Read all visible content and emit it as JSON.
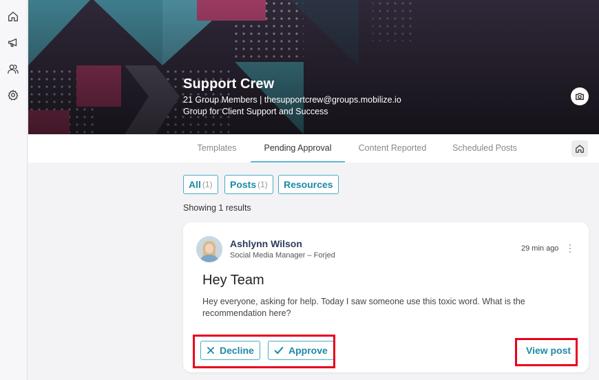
{
  "rail": {
    "items": [
      {
        "icon": "home-icon"
      },
      {
        "icon": "megaphone-icon"
      },
      {
        "icon": "users-icon"
      },
      {
        "icon": "gear-icon"
      }
    ]
  },
  "group": {
    "title": "Support Crew",
    "meta": "21 Group Members | thesupportcrew@groups.mobilize.io",
    "description": "Group for Client Support and Success"
  },
  "tabs": [
    {
      "label": "Templates",
      "active": false
    },
    {
      "label": "Pending Approval",
      "active": true
    },
    {
      "label": "Content Reported",
      "active": false
    },
    {
      "label": "Scheduled Posts",
      "active": false
    }
  ],
  "filters": [
    {
      "label": "All",
      "count": "(1)"
    },
    {
      "label": "Posts",
      "count": "(1)"
    },
    {
      "label": "Resources",
      "count": ""
    }
  ],
  "results_text": "Showing 1 results",
  "post": {
    "author": "Ashlynn Wilson",
    "role": "Social Media Manager – Forjed",
    "time": "29 min ago",
    "title": "Hey Team",
    "body": "Hey everyone, asking for help. Today I saw someone use this toxic word. What is the recommendation here?",
    "decline_label": "Decline",
    "approve_label": "Approve",
    "view_label": "View post"
  },
  "colors": {
    "accent": "#1d8aa6",
    "highlight": "#e8001c",
    "banner": "#2e2637"
  }
}
